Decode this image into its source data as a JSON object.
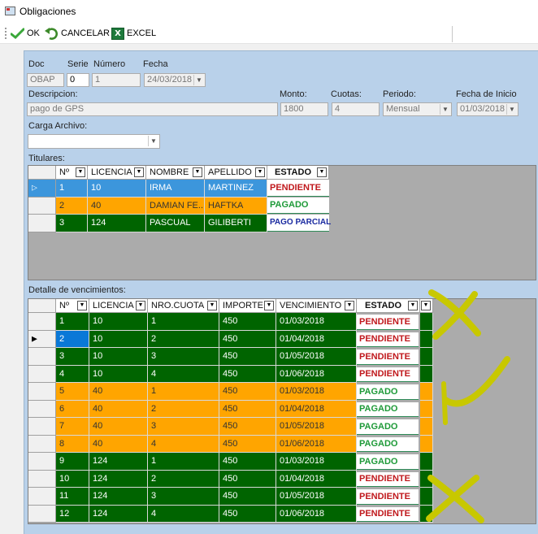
{
  "window": {
    "title": "Obligaciones"
  },
  "toolbar": {
    "ok_label": "OK",
    "cancel_label": "CANCELAR",
    "excel_label": "EXCEL",
    "excel_glyph": "X"
  },
  "form": {
    "doc_label": "Doc",
    "doc_value": "OBAP",
    "serie_label": "Serie",
    "serie_value": "0",
    "numero_label": "Número",
    "numero_value": "1",
    "fecha_label": "Fecha",
    "fecha_value": "24/03/2018",
    "descripcion_label": "Descripcion:",
    "descripcion_value": "pago de GPS",
    "monto_label": "Monto:",
    "monto_value": "1800",
    "cuotas_label": "Cuotas:",
    "cuotas_value": "4",
    "periodo_label": "Periodo:",
    "periodo_value": "Mensual",
    "fecha_inicio_label": "Fecha de Inicio",
    "fecha_inicio_value": "01/03/2018",
    "carga_label": "Carga Archivo:",
    "carga_value": ""
  },
  "titulares": {
    "label": "Titulares:",
    "columns": [
      "Nº",
      "LICENCIA",
      "NOMBRE",
      "APELLIDO",
      "ESTADO"
    ],
    "rows": [
      {
        "n": "1",
        "licencia": "10",
        "nombre": "IRMA",
        "apellido": "MARTINEZ",
        "estado": "PENDIENTE",
        "color": "blue"
      },
      {
        "n": "2",
        "licencia": "40",
        "nombre": "DAMIAN FE...",
        "apellido": "HAFTKA",
        "estado": "PAGADO",
        "color": "orange"
      },
      {
        "n": "3",
        "licencia": "124",
        "nombre": "PASCUAL",
        "apellido": "GILIBERTI",
        "estado": "PAGO PARCIAL",
        "color": "green"
      }
    ]
  },
  "detalle": {
    "label": "Detalle de vencimientos:",
    "columns": [
      "Nº",
      "LICENCIA",
      "NRO.CUOTA",
      "IMPORTE",
      "VENCIMIENTO",
      "ESTADO"
    ],
    "rows": [
      {
        "n": "1",
        "licencia": "10",
        "cuota": "1",
        "importe": "450",
        "venc": "01/03/2018",
        "estado": "PENDIENTE",
        "color": "green"
      },
      {
        "n": "2",
        "licencia": "10",
        "cuota": "2",
        "importe": "450",
        "venc": "01/04/2018",
        "estado": "PENDIENTE",
        "color": "green"
      },
      {
        "n": "3",
        "licencia": "10",
        "cuota": "3",
        "importe": "450",
        "venc": "01/05/2018",
        "estado": "PENDIENTE",
        "color": "green"
      },
      {
        "n": "4",
        "licencia": "10",
        "cuota": "4",
        "importe": "450",
        "venc": "01/06/2018",
        "estado": "PENDIENTE",
        "color": "green"
      },
      {
        "n": "5",
        "licencia": "40",
        "cuota": "1",
        "importe": "450",
        "venc": "01/03/2018",
        "estado": "PAGADO",
        "color": "orange"
      },
      {
        "n": "6",
        "licencia": "40",
        "cuota": "2",
        "importe": "450",
        "venc": "01/04/2018",
        "estado": "PAGADO",
        "color": "orange"
      },
      {
        "n": "7",
        "licencia": "40",
        "cuota": "3",
        "importe": "450",
        "venc": "01/05/2018",
        "estado": "PAGADO",
        "color": "orange"
      },
      {
        "n": "8",
        "licencia": "40",
        "cuota": "4",
        "importe": "450",
        "venc": "01/06/2018",
        "estado": "PAGADO",
        "color": "orange"
      },
      {
        "n": "9",
        "licencia": "124",
        "cuota": "1",
        "importe": "450",
        "venc": "01/03/2018",
        "estado": "PAGADO",
        "color": "green"
      },
      {
        "n": "10",
        "licencia": "124",
        "cuota": "2",
        "importe": "450",
        "venc": "01/04/2018",
        "estado": "PENDIENTE",
        "color": "green"
      },
      {
        "n": "11",
        "licencia": "124",
        "cuota": "3",
        "importe": "450",
        "venc": "01/05/2018",
        "estado": "PENDIENTE",
        "color": "green"
      },
      {
        "n": "12",
        "licencia": "124",
        "cuota": "4",
        "importe": "450",
        "venc": "01/06/2018",
        "estado": "PENDIENTE",
        "color": "green"
      }
    ]
  },
  "colors": {
    "green": "#006400",
    "orange": "#ffa500",
    "blue": "#3c96dc",
    "pendiente": "#c0181c",
    "pagado": "#1e9a38",
    "parcial": "#1a2aa0",
    "annotation": "#c8c800"
  }
}
